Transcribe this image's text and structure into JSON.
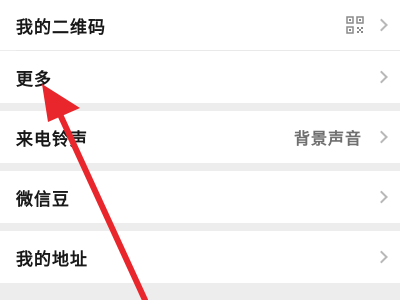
{
  "menu": {
    "items": [
      {
        "label": "我的二维码",
        "icon": "qr-code-icon"
      },
      {
        "label": "更多"
      },
      {
        "label": "来电铃声",
        "value": "背景声音"
      },
      {
        "label": "微信豆"
      },
      {
        "label": "我的地址"
      }
    ]
  },
  "colors": {
    "background": "#ededed",
    "row": "#ffffff",
    "arrow": "#e8262b",
    "chevron": "#b8b8b8"
  }
}
